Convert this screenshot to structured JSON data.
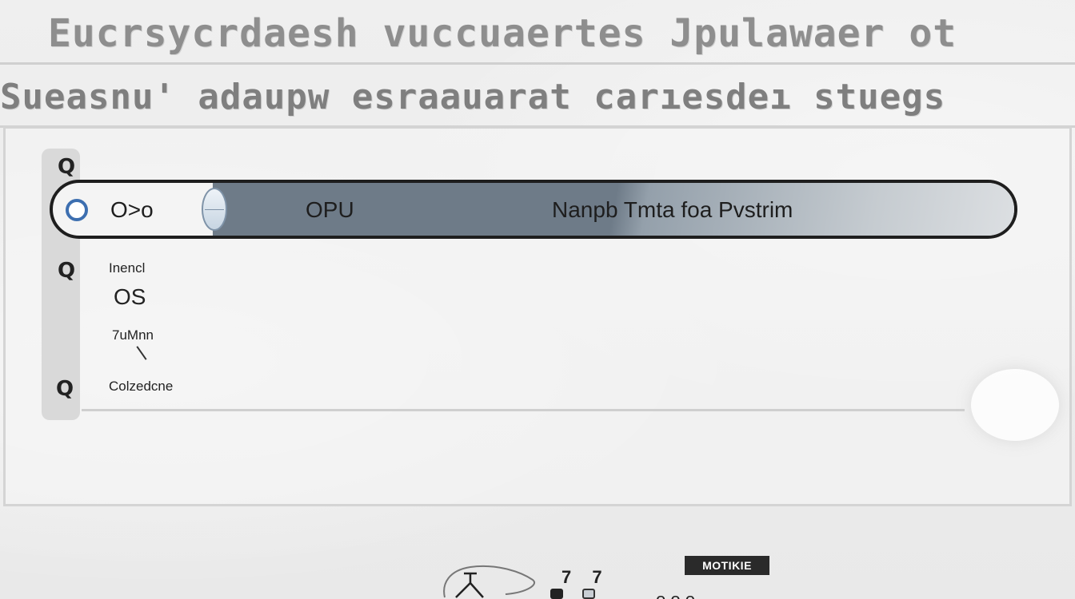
{
  "header": {
    "title_line_1": "Eucrsycrdaesh vuccuaertes Jpulawaer ot",
    "title_line_2": "Sueasnu' adaupw esraauarat carıesdeı stuegs"
  },
  "rail": {
    "icons": [
      "q-icon",
      "q-icon",
      "q-icon"
    ],
    "glyph": "Q"
  },
  "progress": {
    "left_value": "O>o",
    "mid_value": "OPU",
    "label": "Nanpb  Tmta  foa  Pvstrim",
    "fill_fraction": 0.85
  },
  "fields": {
    "label_1": "Inencl",
    "value_1": "OS",
    "label_2": "7uMnn",
    "label_3": "Colzedcne"
  },
  "footer": {
    "badge": "MOTIKIE",
    "digits": "7 7",
    "tail": "o o o"
  },
  "colors": {
    "accent": "#3d6fb0",
    "fill": "#6e7b88",
    "badge_bg": "#2a2a2a"
  }
}
